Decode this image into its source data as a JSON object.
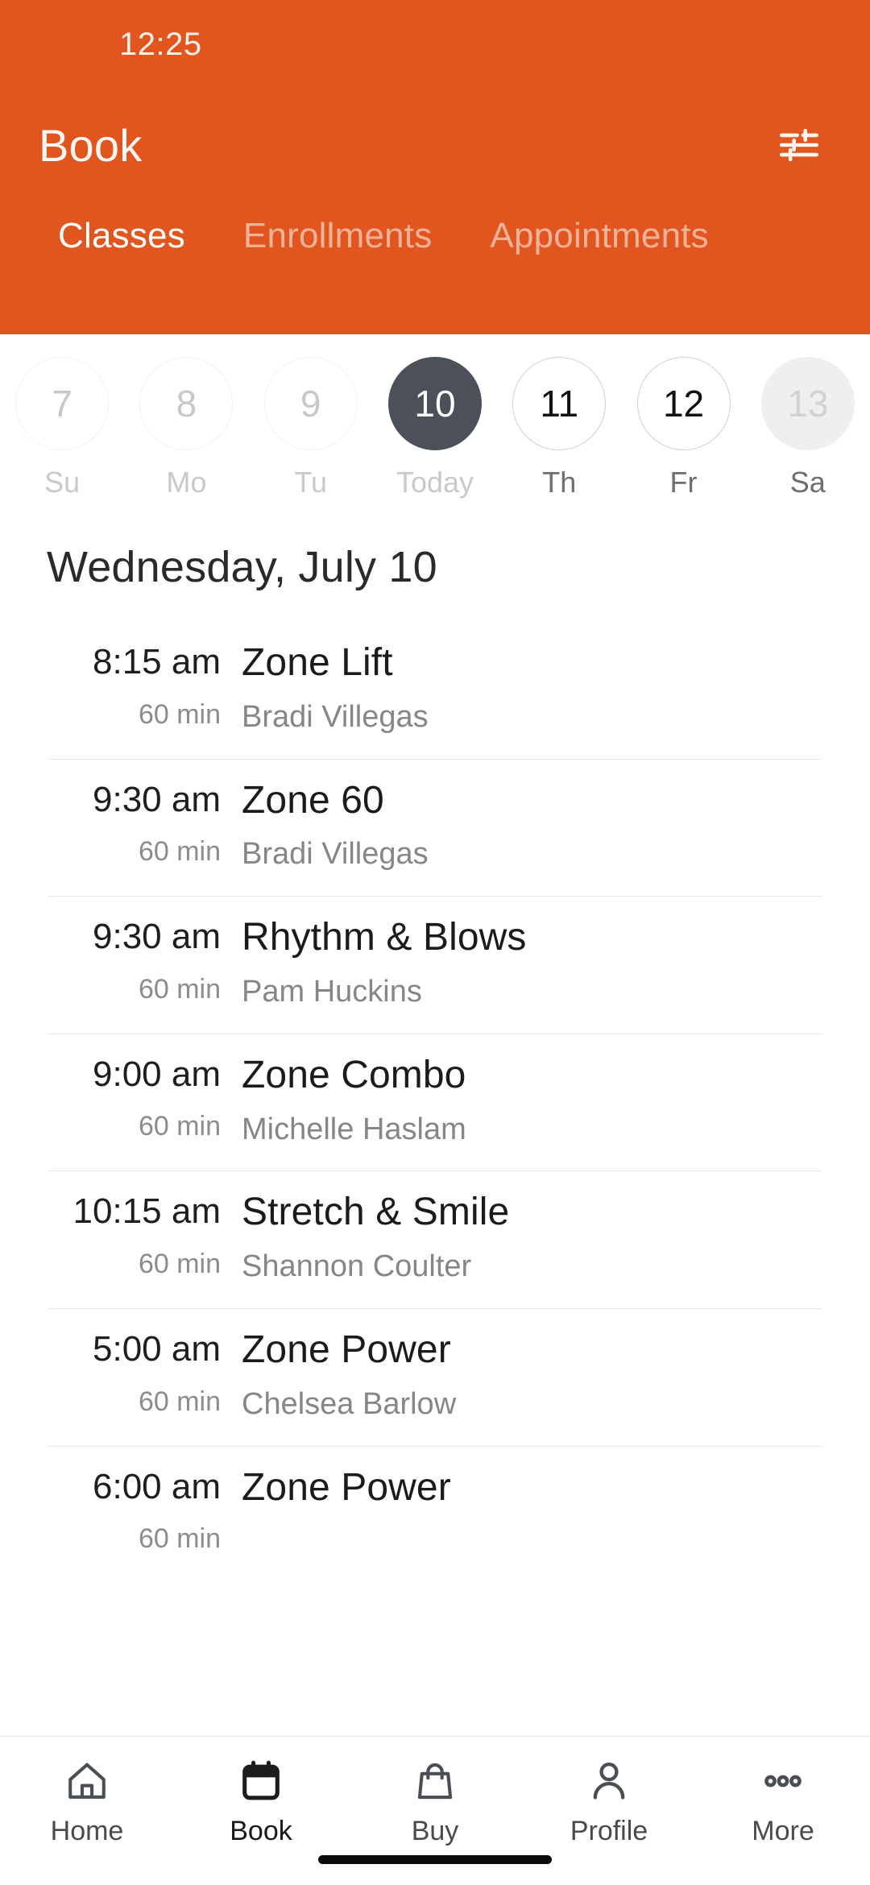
{
  "status_bar": {
    "time": "12:25"
  },
  "header": {
    "title": "Book",
    "filter_icon": "sliders-filter-icon",
    "accent_color": "#E1551F",
    "tabs": [
      {
        "label": "Classes",
        "active": true
      },
      {
        "label": "Enrollments",
        "active": false
      },
      {
        "label": "Appointments",
        "active": false
      }
    ]
  },
  "date_strip": {
    "days": [
      {
        "num": "7",
        "label": "Su",
        "state": "past"
      },
      {
        "num": "8",
        "label": "Mo",
        "state": "past"
      },
      {
        "num": "9",
        "label": "Tu",
        "state": "past"
      },
      {
        "num": "10",
        "label": "Today",
        "state": "today"
      },
      {
        "num": "11",
        "label": "Th",
        "state": "future"
      },
      {
        "num": "12",
        "label": "Fr",
        "state": "future"
      },
      {
        "num": "13",
        "label": "Sa",
        "state": "disabled"
      }
    ]
  },
  "schedule": {
    "date_heading": "Wednesday, July 10",
    "classes": [
      {
        "time": "8:15 am",
        "duration": "60 min",
        "name": "Zone Lift",
        "instructor": "Bradi Villegas"
      },
      {
        "time": "9:30 am",
        "duration": "60 min",
        "name": "Zone 60",
        "instructor": "Bradi Villegas"
      },
      {
        "time": "9:30 am",
        "duration": "60 min",
        "name": "Rhythm & Blows",
        "instructor": "Pam Huckins"
      },
      {
        "time": "9:00 am",
        "duration": "60 min",
        "name": "Zone Combo",
        "instructor": "Michelle Haslam"
      },
      {
        "time": "10:15 am",
        "duration": "60 min",
        "name": "Stretch & Smile",
        "instructor": "Shannon Coulter"
      },
      {
        "time": "5:00 am",
        "duration": "60 min",
        "name": "Zone Power",
        "instructor": "Chelsea Barlow"
      },
      {
        "time": "6:00 am",
        "duration": "60 min",
        "name": "Zone Power",
        "instructor": ""
      }
    ]
  },
  "bottom_nav": {
    "items": [
      {
        "label": "Home",
        "icon": "house-icon",
        "active": false
      },
      {
        "label": "Book",
        "icon": "calendar-icon",
        "active": true
      },
      {
        "label": "Buy",
        "icon": "shopping-bag-icon",
        "active": false
      },
      {
        "label": "Profile",
        "icon": "person-icon",
        "active": false
      },
      {
        "label": "More",
        "icon": "ellipsis-icon",
        "active": false
      }
    ]
  }
}
